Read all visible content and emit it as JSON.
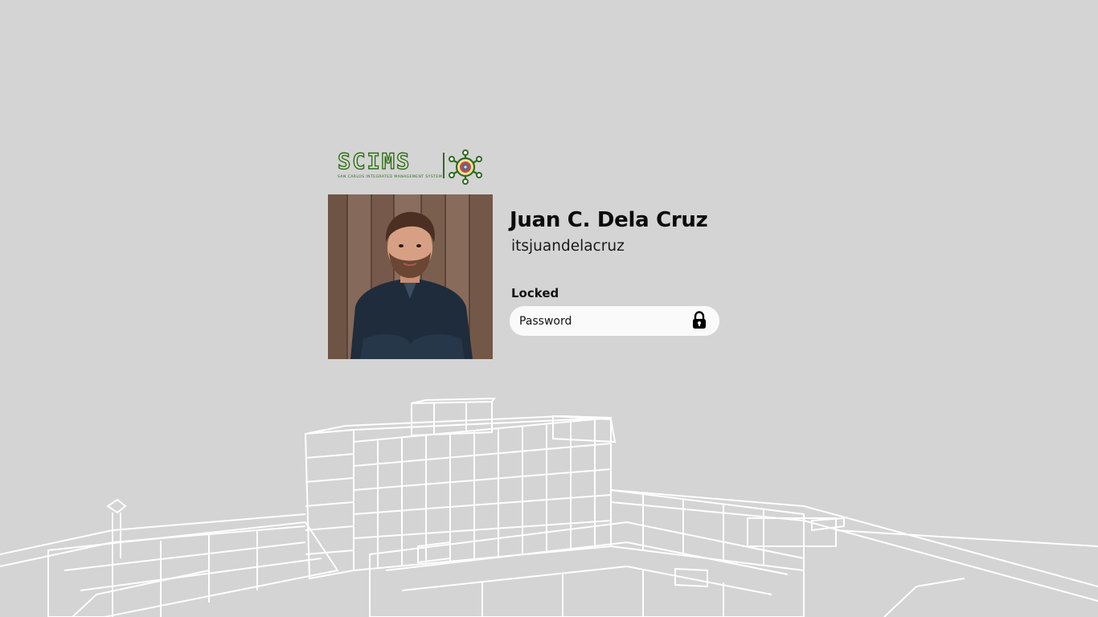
{
  "logo": {
    "title": "SCIMS",
    "subtitle": "SAN CARLOS INTEGRATED MANAGEMENT SYSTEM"
  },
  "user": {
    "name": "Juan C. Dela Cruz",
    "handle": "itsjuandelacruz"
  },
  "lock": {
    "status": "Locked"
  },
  "password": {
    "placeholder": "Password",
    "value": ""
  },
  "icons": {
    "unlock_button": "padlock-icon",
    "seal": "city-seal-icon",
    "backdrop": "building-line-art"
  },
  "colors": {
    "background": "#d4d4d4",
    "logo_green": "#2e6b1f",
    "input_bg": "#fafafa",
    "text": "#0a0a0a"
  }
}
